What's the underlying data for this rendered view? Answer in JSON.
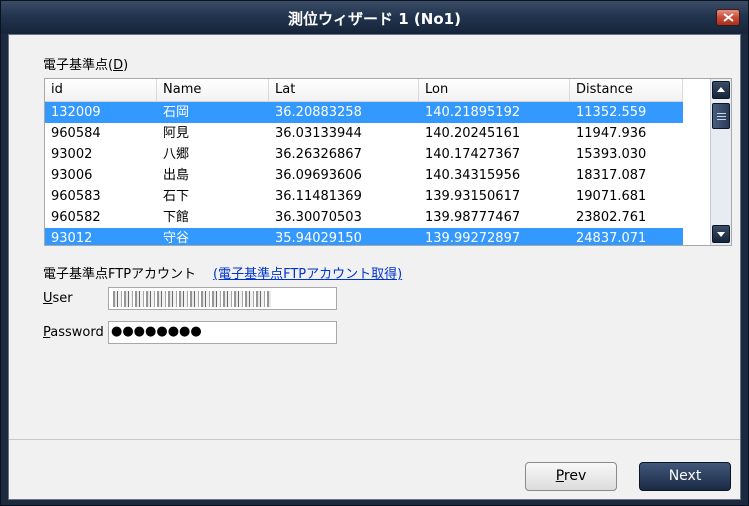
{
  "window": {
    "title": "測位ウィザード 1 (No1)"
  },
  "station_list": {
    "label_text": "電子基準点(",
    "label_mnemonic": "D",
    "label_close": ")",
    "columns": [
      "id",
      "Name",
      "Lat",
      "Lon",
      "Distance"
    ],
    "rows": [
      {
        "id": "132009",
        "name": "石岡",
        "lat": "36.20883258",
        "lon": "140.21895192",
        "distance": "11352.559",
        "selected": true
      },
      {
        "id": "960584",
        "name": "阿見",
        "lat": "36.03133944",
        "lon": "140.20245161",
        "distance": "11947.936",
        "selected": false
      },
      {
        "id": "93002",
        "name": "八郷",
        "lat": "36.26326867",
        "lon": "140.17427367",
        "distance": "15393.030",
        "selected": false
      },
      {
        "id": "93006",
        "name": "出島",
        "lat": "36.09693606",
        "lon": "140.34315956",
        "distance": "18317.087",
        "selected": false
      },
      {
        "id": "960583",
        "name": "石下",
        "lat": "36.11481369",
        "lon": "139.93150617",
        "distance": "19071.681",
        "selected": false
      },
      {
        "id": "960582",
        "name": "下館",
        "lat": "36.30070503",
        "lon": "139.98777467",
        "distance": "23802.761",
        "selected": false
      },
      {
        "id": "93012",
        "name": "守谷",
        "lat": "35.94029150",
        "lon": "139.99272897",
        "distance": "24837.071",
        "selected": true
      }
    ]
  },
  "ftp": {
    "label": "電子基準点FTPアカウント",
    "link": "(電子基準点FTPアカウント取得)"
  },
  "user": {
    "label_mnemonic": "U",
    "label_rest": "ser"
  },
  "password": {
    "label_mnemonic": "P",
    "label_rest": "assword",
    "value": "●●●●●●●●"
  },
  "buttons": {
    "prev_mnemonic": "P",
    "prev_rest": "rev",
    "next": "Next"
  },
  "colors": {
    "selection": "#3399ff",
    "titlebar": "#22344e",
    "link": "#0033cc"
  }
}
